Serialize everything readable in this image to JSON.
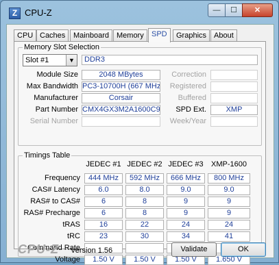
{
  "window": {
    "title": "CPU-Z",
    "icon_letter": "Z",
    "minimize": "—",
    "maximize": "☐",
    "close": "✕"
  },
  "tabs": [
    "CPU",
    "Caches",
    "Mainboard",
    "Memory",
    "SPD",
    "Graphics",
    "About"
  ],
  "active_tab": "SPD",
  "memory_slot": {
    "title": "Memory Slot Selection",
    "slot": "Slot #1",
    "type": "DDR3",
    "module_size_label": "Module Size",
    "module_size": "2048 MBytes",
    "max_bandwidth_label": "Max Bandwidth",
    "max_bandwidth": "PC3-10700H (667 MHz)",
    "manufacturer_label": "Manufacturer",
    "manufacturer": "Corsair",
    "part_number_label": "Part Number",
    "part_number": "CMX4GX3M2A1600C9",
    "serial_number_label": "Serial Number",
    "serial_number": "",
    "correction_label": "Correction",
    "correction": "",
    "registered_label": "Registered",
    "registered": "",
    "buffered_label": "Buffered",
    "buffered": "",
    "spd_ext_label": "SPD Ext.",
    "spd_ext": "XMP",
    "week_year_label": "Week/Year",
    "week_year": ""
  },
  "timings": {
    "title": "Timings Table",
    "columns": [
      "JEDEC #1",
      "JEDEC #2",
      "JEDEC #3",
      "XMP-1600"
    ],
    "rows": [
      {
        "label": "Frequency",
        "values": [
          "444 MHz",
          "592 MHz",
          "666 MHz",
          "800 MHz"
        ]
      },
      {
        "label": "CAS# Latency",
        "values": [
          "6.0",
          "8.0",
          "9.0",
          "9.0"
        ]
      },
      {
        "label": "RAS# to CAS#",
        "values": [
          "6",
          "8",
          "9",
          "9"
        ]
      },
      {
        "label": "RAS# Precharge",
        "values": [
          "6",
          "8",
          "9",
          "9"
        ]
      },
      {
        "label": "tRAS",
        "values": [
          "16",
          "22",
          "24",
          "24"
        ]
      },
      {
        "label": "tRC",
        "values": [
          "23",
          "30",
          "34",
          "41"
        ]
      },
      {
        "label": "Command Rate",
        "values": [
          "",
          "",
          "",
          "2T"
        ]
      },
      {
        "label": "Voltage",
        "values": [
          "1.50 V",
          "1.50 V",
          "1.50 V",
          "1.650 V"
        ]
      }
    ]
  },
  "footer": {
    "logo": "CPU-Z",
    "version": "Version 1.56",
    "validate": "Validate",
    "ok": "OK"
  }
}
